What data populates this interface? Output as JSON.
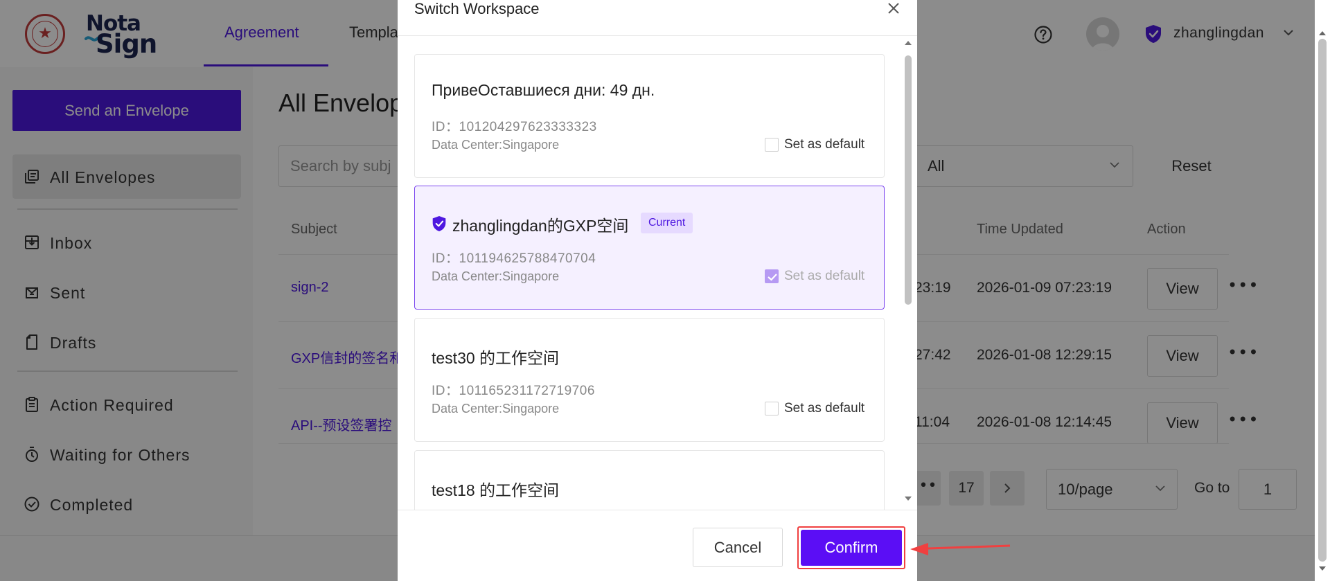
{
  "header": {
    "logo_text_top": "Nota",
    "logo_text_bottom": "Sign",
    "tabs": [
      {
        "label": "Agreement",
        "active": true
      },
      {
        "label": "Templa",
        "active": false
      }
    ],
    "user": {
      "name": "zhanglingdan"
    },
    "icons": {
      "help": "help-icon",
      "user_badge": "shield-icon",
      "dropdown": "chevron-down-icon"
    }
  },
  "sidebar": {
    "send_button": "Send an Envelope",
    "items": [
      {
        "label": "All Envelopes",
        "icon": "envelopes-icon",
        "active": true
      },
      {
        "label": "Inbox",
        "icon": "inbox-icon"
      },
      {
        "label": "Sent",
        "icon": "sent-icon"
      },
      {
        "label": "Drafts",
        "icon": "drafts-icon"
      },
      {
        "label": "Action Required",
        "icon": "clipboard-icon"
      },
      {
        "label": "Waiting for Others",
        "icon": "timer-icon"
      },
      {
        "label": "Completed",
        "icon": "check-circle-icon"
      }
    ]
  },
  "main": {
    "title": "All Envelop",
    "search_placeholder": "Search by subj",
    "status_filter": "All",
    "reset_label": "Reset",
    "columns": {
      "subject": "Subject",
      "time_updated": "Time Updated",
      "action": "Action"
    },
    "rows": [
      {
        "subject": "sign-2",
        "time_a": "23:19",
        "time_updated": "2026-01-09 07:23:19",
        "action": "View"
      },
      {
        "subject": "GXP信封的签名和",
        "time_a": "27:42",
        "time_updated": "2026-01-08 12:29:15",
        "action": "View"
      },
      {
        "subject": "API--预设签署控",
        "time_a": "11:04",
        "time_updated": "2026-01-08 12:14:45",
        "action": "View"
      }
    ],
    "pagination": {
      "ellipsis": "•••",
      "last_page": "17",
      "page_size": "10/page",
      "goto_label": "Go to",
      "goto_value": "1"
    }
  },
  "modal": {
    "title": "Switch Workspace",
    "workspaces": [
      {
        "name": "ПривеОставшиеся дни: 49 дн.",
        "id": "ID：101204297623333323",
        "data_center": "Data Center:Singapore",
        "default_label": "Set as default",
        "is_default": false,
        "current": false
      },
      {
        "name": "zhanglingdan的GXP空间",
        "badge": "Current",
        "id": "ID：101194625788470704",
        "data_center": "Data Center:Singapore",
        "default_label": "Set as default",
        "is_default": true,
        "current": true
      },
      {
        "name": "test30 的工作空间",
        "id": "ID：101165231172719706",
        "data_center": "Data Center:Singapore",
        "default_label": "Set as default",
        "is_default": false,
        "current": false
      },
      {
        "name": "test18 的工作空间",
        "current": false
      }
    ],
    "cancel_label": "Cancel",
    "confirm_label": "Confirm"
  },
  "colors": {
    "brand": "#4e18e0",
    "confirm": "#5b0ef5",
    "annotation": "#f04040",
    "current_bg": "#f5f0ff"
  }
}
